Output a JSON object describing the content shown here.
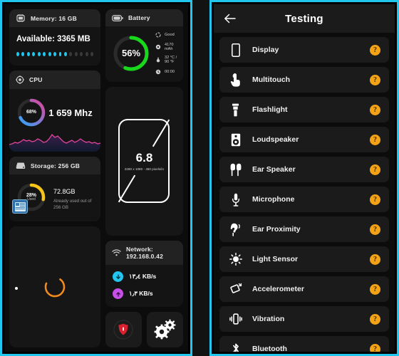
{
  "dashboard": {
    "memory": {
      "title": "Memory: 16 GB",
      "icon": "memory-chip-icon",
      "available": "Available: 3365 MB",
      "dots_total": 15,
      "dots_active": 10
    },
    "cpu": {
      "title": "CPU",
      "icon": "cpu-icon",
      "usage_percent": "68%",
      "frequency": "1 659 Mhz",
      "ring_value": 68,
      "ring_color_start": "#29a8ff",
      "ring_color_end": "#e0449b"
    },
    "storage": {
      "title": "Storage: 256 GB",
      "icon": "storage-drive-icon",
      "used_percent": "28%",
      "used_label": "Used",
      "used_value": "72.8",
      "used_unit": "GB",
      "subtitle": "Already used out of 256 GB",
      "ring_value": 28,
      "ring_color": "#f5c518"
    },
    "loader": {
      "spinner_color": "#f08a1e"
    },
    "battery": {
      "title": "Battery",
      "icon": "battery-icon",
      "percent": "56%",
      "ring_value": 56,
      "ring_color": "#18d81c",
      "details": [
        {
          "icon": "health-icon",
          "text": "Good"
        },
        {
          "icon": "capacity-icon",
          "text": "4170 mAh"
        },
        {
          "icon": "temperature-icon",
          "text": "32 °C / 90 °F"
        },
        {
          "icon": "clock-icon",
          "text": "00:00"
        }
      ]
    },
    "display": {
      "size": "6.8",
      "resolution": "2280 x 1080 - 450 pixels/in"
    },
    "network": {
      "title": "Network: 192.168.0.42",
      "icon": "wifi-icon",
      "download": {
        "icon": "download-arrow-icon",
        "value": "١٣٫٤ KB/s"
      },
      "upload": {
        "icon": "upload-arrow-icon",
        "value": "١٫٣ KB/s"
      }
    },
    "actions": [
      {
        "name": "security-button",
        "icon": "shield-icon",
        "color": "#d8202f"
      },
      {
        "name": "settings-button",
        "icon": "gears-icon",
        "color": "#ffffff"
      }
    ]
  },
  "testing": {
    "back_icon": "back-arrow-icon",
    "title": "Testing",
    "status_symbol": "?",
    "status_color": "#f5a316",
    "items": [
      {
        "label": "Display",
        "icon": "phone-outline-icon",
        "status": "?"
      },
      {
        "label": "Multitouch",
        "icon": "touch-hand-icon",
        "status": "?"
      },
      {
        "label": "Flashlight",
        "icon": "flashlight-icon",
        "status": "?"
      },
      {
        "label": "Loudspeaker",
        "icon": "loudspeaker-icon",
        "status": "?"
      },
      {
        "label": "Ear Speaker",
        "icon": "earbuds-icon",
        "status": "?"
      },
      {
        "label": "Microphone",
        "icon": "microphone-icon",
        "status": "?"
      },
      {
        "label": "Ear Proximity",
        "icon": "ear-proximity-icon",
        "status": "?"
      },
      {
        "label": "Light Sensor",
        "icon": "light-sensor-icon",
        "status": "?"
      },
      {
        "label": "Accelerometer",
        "icon": "accelerometer-icon",
        "status": "?"
      },
      {
        "label": "Vibration",
        "icon": "vibration-icon",
        "status": "?"
      },
      {
        "label": "Bluetooth",
        "icon": "bluetooth-icon",
        "status": "?"
      }
    ]
  }
}
